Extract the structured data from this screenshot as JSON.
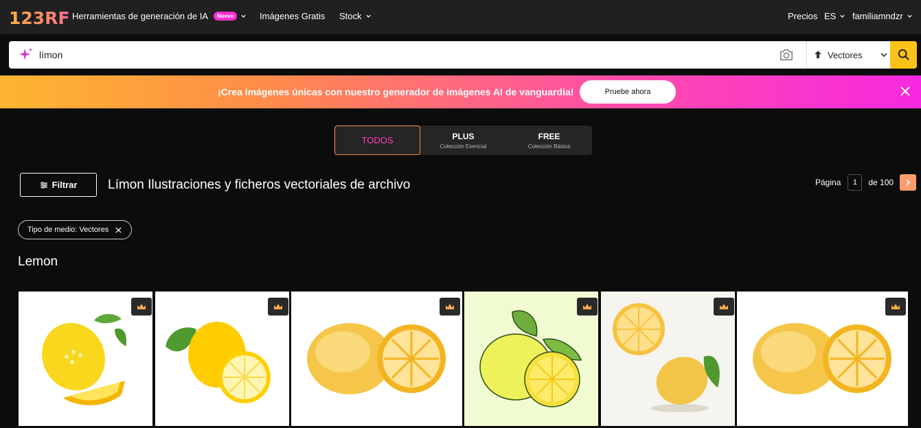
{
  "header": {
    "logo": "123RF",
    "nav": {
      "ai_tools": "Herramientas de generación de IA",
      "ai_badge": "Nuevo",
      "free_images": "Imágenes Gratis",
      "stock": "Stock"
    },
    "pricing": "Precios",
    "language": "ES",
    "user": "familiamndzr"
  },
  "search": {
    "value": "límon",
    "media_type": "Vectores"
  },
  "banner": {
    "text": "¡Crea imágenes únicas con nuestro generador de imágenes AI de vanguardia!",
    "cta": "Pruebe ahora"
  },
  "tabs": [
    {
      "title": "TODOS",
      "subtitle": ""
    },
    {
      "title": "PLUS",
      "subtitle": "Colección Esencial"
    },
    {
      "title": "FREE",
      "subtitle": "Colección Básica"
    }
  ],
  "filter_label": "Filtrar",
  "page_title": "Límon Ilustraciones y ficheros vectoriales de archivo",
  "pagination": {
    "label": "Página",
    "current": "1",
    "of_label": "de 100"
  },
  "active_filter": "Tipo de medio: Vectores",
  "section_title": "Lemon",
  "colors": {
    "accent_pink": "#ff3fc0",
    "accent_yellow": "#fdc21a",
    "topbar": "#202020",
    "background": "#0c0c0c"
  },
  "icons": [
    "sparkle-icon",
    "camera-icon",
    "upload-icon",
    "chevron-down-icon",
    "search-icon",
    "close-icon",
    "filter-icon",
    "chevron-right-icon",
    "crown-icon"
  ]
}
